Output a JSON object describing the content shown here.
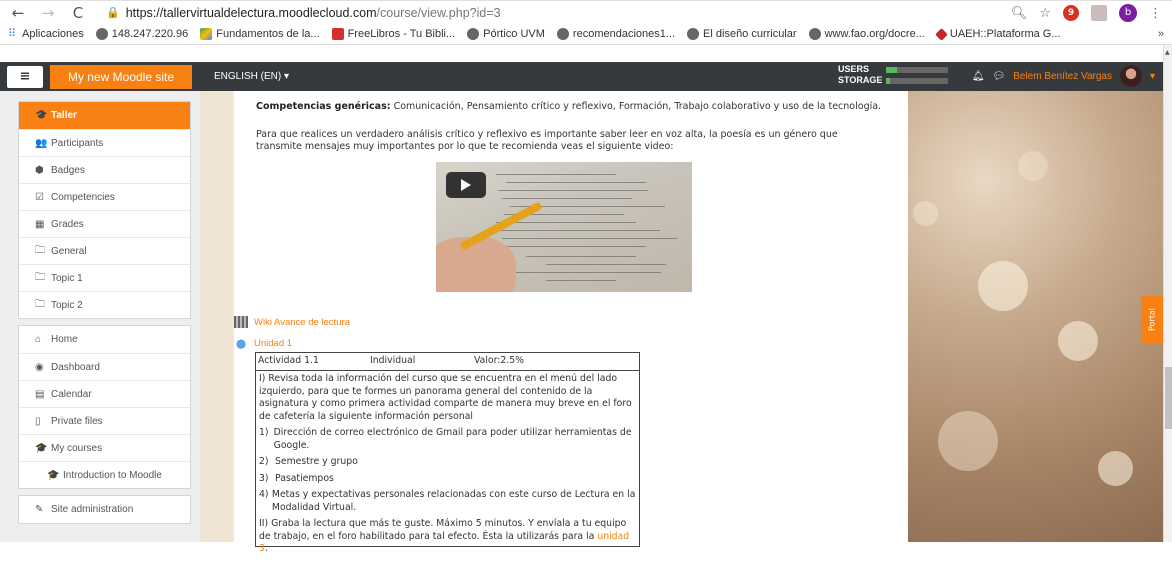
{
  "browser": {
    "url_host": "https://tallervirtualdelectura.moodlecloud.com",
    "url_path": "/course/view.php?id=3",
    "ext_badge": "9",
    "profile_initial": "b"
  },
  "bookmarks": [
    {
      "label": "Aplicaciones",
      "icon": "apps-icon"
    },
    {
      "label": "148.247.220.96",
      "icon": "globe-icon"
    },
    {
      "label": "Fundamentos de la...",
      "icon": "drive-icon"
    },
    {
      "label": "FreeLibros - Tu Bibli...",
      "icon": "book-icon"
    },
    {
      "label": "Pórtico UVM",
      "icon": "globe-icon"
    },
    {
      "label": "recomendaciones1...",
      "icon": "globe-icon"
    },
    {
      "label": "El diseño curricular",
      "icon": "globe-icon"
    },
    {
      "label": "www.fao.org/docre...",
      "icon": "globe-icon"
    },
    {
      "label": "UAEH::Plataforma G...",
      "icon": "uaeh-icon"
    }
  ],
  "bookmarks_more": "»",
  "navbar": {
    "menu_icon": "≡",
    "brand": "My new Moodle site",
    "language": "ENGLISH (EN) ▾",
    "usage_users": "USERS",
    "usage_storage": "STORAGE",
    "user_name": "Belem Benítez Vargas",
    "user_caret": "▾"
  },
  "drawer": {
    "course_items": [
      {
        "label": "Taller",
        "icon": "graduation-cap-icon",
        "glyph": "🎓",
        "active": true
      },
      {
        "label": "Participants",
        "icon": "users-icon",
        "glyph": "👥"
      },
      {
        "label": "Badges",
        "icon": "shield-icon",
        "glyph": "⬢"
      },
      {
        "label": "Competencies",
        "icon": "check-square-icon",
        "glyph": "☑"
      },
      {
        "label": "Grades",
        "icon": "table-icon",
        "glyph": "▦"
      },
      {
        "label": "General",
        "icon": "folder-icon",
        "glyph": "🗀"
      },
      {
        "label": "Topic 1",
        "icon": "folder-icon",
        "glyph": "🗀"
      },
      {
        "label": "Topic 2",
        "icon": "folder-icon",
        "glyph": "🗀"
      }
    ],
    "site_items": [
      {
        "label": "Home",
        "icon": "home-icon",
        "glyph": "⌂"
      },
      {
        "label": "Dashboard",
        "icon": "dashboard-icon",
        "glyph": "◉"
      },
      {
        "label": "Calendar",
        "icon": "calendar-icon",
        "glyph": "▤"
      },
      {
        "label": "Private files",
        "icon": "file-icon",
        "glyph": "▯"
      },
      {
        "label": "My courses",
        "icon": "graduation-cap-icon",
        "glyph": "🎓"
      },
      {
        "label": "Introduction to Moodle",
        "icon": "graduation-cap-icon",
        "glyph": "🎓",
        "sub": true
      }
    ],
    "admin_items": [
      {
        "label": "Site administration",
        "icon": "wrench-icon",
        "glyph": "✎"
      }
    ]
  },
  "content": {
    "competencias_label": "Competencias genéricas:",
    "competencias_text": " Comunicación, Pensamiento crítico  y reflexivo, Formación, Trabajo colaborativo  y uso de la tecnología.",
    "intro": "Para que realices un verdadero análisis crítico y reflexivo es importante saber leer en voz alta, la poesía es un género que transmite mensajes muy importantes por lo que te recomienda veas el siguiente video:",
    "wiki_link": "Wiki Avance de lectura",
    "unit_link": "Unidad 1",
    "activity": {
      "col1": "Actividad 1.1",
      "col2": "Individual",
      "col3": "Valor:2.5%",
      "para1": "I) Revisa toda la información del curso que se encuentra en el menú del lado izquierdo, para que te formes un panorama general del contenido de la asignatura y como primera actividad comparte de manera muy breve en el foro de cafetería la siguiente información personal",
      "list": [
        {
          "n": "1)",
          "text": "Dirección de correo electrónico de Gmail para poder utilizar herramientas de Google."
        },
        {
          "n": "2)",
          "text": "Semestre y grupo"
        },
        {
          "n": "3)",
          "text": "Pasatiempos"
        },
        {
          "n": "4)",
          "text": "Metas y expectativas personales relacionadas con este curso de Lectura  en la Modalidad Virtual."
        }
      ],
      "para2": "II) Graba la lectura que más te guste. Máximo 5 minutos. Y envíala a tu equipo de trabajo, en el foro habilitado para tal efecto. Ésta la utilizarás para la ",
      "para2_link": "unidad 3",
      "para2_end": "."
    }
  },
  "portal_tab": "Portal",
  "colors": {
    "brand": "#f98012",
    "navbar": "#373a3c"
  }
}
